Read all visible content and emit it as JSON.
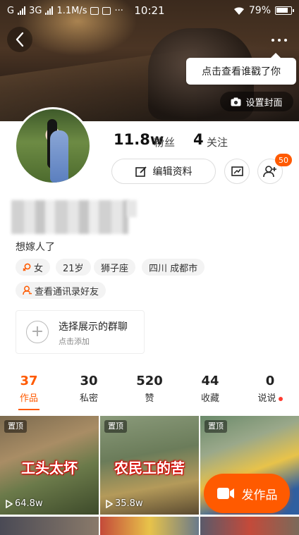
{
  "status_bar": {
    "carrier1": "G",
    "carrier2": "3G",
    "speed": "1.1M/s",
    "time": "10:21",
    "battery": "79%",
    "dots": "···"
  },
  "header": {
    "tooltip": "点击查看谁戳了你",
    "set_cover": "设置封面"
  },
  "profile": {
    "fans_count": "11.8w",
    "fans_label": "粉丝",
    "following_count": "4",
    "following_label": "关注",
    "edit_label": "编辑资料",
    "friend_badge": "50",
    "bio": "想嫁人了",
    "tags": [
      "女",
      "21岁",
      "狮子座",
      "四川 成都市"
    ],
    "contacts_label": "查看通讯录好友"
  },
  "group_card": {
    "title": "选择展示的群聊",
    "subtitle": "点击添加"
  },
  "tabs": [
    {
      "count": "37",
      "label": "作品",
      "active": true
    },
    {
      "count": "30",
      "label": "私密"
    },
    {
      "count": "520",
      "label": "赞"
    },
    {
      "count": "44",
      "label": "收藏"
    },
    {
      "count": "0",
      "label": "说说"
    }
  ],
  "videos": [
    {
      "pinned": "置顶",
      "caption": "工头太坏",
      "views": "64.8w"
    },
    {
      "pinned": "置顶",
      "caption": "农民工的苦",
      "views": "35.8w"
    },
    {
      "pinned": "置顶",
      "caption": "",
      "views": ""
    }
  ],
  "fab": {
    "label": "发作品"
  },
  "colors": {
    "accent": "#ff5a00"
  }
}
